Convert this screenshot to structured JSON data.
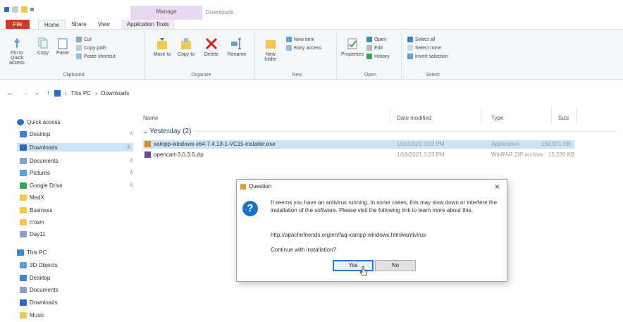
{
  "titlebar": {
    "context_tab": "Manage",
    "window_title": "Downloads"
  },
  "tabs": [
    {
      "label": "File"
    },
    {
      "label": "Home"
    },
    {
      "label": "Share"
    },
    {
      "label": "View"
    },
    {
      "label": "Application Tools"
    }
  ],
  "ribbon": {
    "clipboard": {
      "label": "Clipboard",
      "pin": "Pin to Quick access",
      "copy": "Copy",
      "paste": "Paste",
      "cut": "Cut",
      "copy_path": "Copy path",
      "paste_shortcut": "Paste shortcut"
    },
    "organize": {
      "label": "Organize",
      "move_to": "Move to",
      "copy_to": "Copy to",
      "delete": "Delete",
      "rename": "Rename"
    },
    "new": {
      "label": "New",
      "new_folder": "New folder",
      "new_item": "New item",
      "easy_access": "Easy access"
    },
    "open": {
      "label": "Open",
      "properties": "Properties",
      "open": "Open",
      "edit": "Edit",
      "history": "History"
    },
    "select": {
      "label": "Select",
      "select_all": "Select all",
      "select_none": "Select none",
      "invert": "Invert selection"
    }
  },
  "addressbar": {
    "crumbs": [
      "This PC",
      "Downloads"
    ]
  },
  "navpane": {
    "items": [
      {
        "label": "Quick access",
        "color": "#1e73c9"
      },
      {
        "label": "Desktop",
        "color": "#3a86d4"
      },
      {
        "label": "Downloads",
        "color": "#2b6cc0"
      },
      {
        "label": "Documents",
        "color": "#8aa4c0"
      },
      {
        "label": "Pictures",
        "color": "#5aa0d8"
      },
      {
        "label": "Google Drive",
        "color": "#36a852"
      },
      {
        "label": "MedX",
        "color": "#f2c94c"
      },
      {
        "label": "Business",
        "color": "#f2c94c"
      },
      {
        "label": "n'own",
        "color": "#f2c94c"
      },
      {
        "label": "Day11",
        "color": "#8aa4c0"
      },
      {
        "label": "This PC",
        "color": "#3a86d4"
      },
      {
        "label": "3D Objects",
        "color": "#5aa0d8"
      },
      {
        "label": "Desktop",
        "color": "#3a86d4"
      },
      {
        "label": "Documents",
        "color": "#8aa4c0"
      },
      {
        "label": "Downloads",
        "color": "#2b6cc0"
      },
      {
        "label": "Music",
        "color": "#f2c94c"
      }
    ]
  },
  "filelist": {
    "columns": [
      "Name",
      "Date modified",
      "Type",
      "Size"
    ],
    "group": "Yesterday (2)",
    "rows": [
      {
        "name": "xampp-windows-x64-7.4.13-1-VC15-installer.exe",
        "date": "1/19/2021 3:03 PM",
        "type": "Application",
        "size": "156,871 KB"
      },
      {
        "name": "opencart-3.0.3.6.zip",
        "date": "1/19/2021 3:23 PM",
        "type": "WinRAR ZIP archive",
        "size": "15,220 KB"
      }
    ]
  },
  "dialog": {
    "title": "Question",
    "close": "×",
    "icon": "?",
    "message": "It seems you have an antivirus running. In some cases, this may slow down or interfere the installation of the software. Please visit the following link to learn more about this.",
    "url": "http://apachefriends.org/en/faq-xampp-windows.html#antivirus",
    "question": "Continue with installation?",
    "yes": "Yes",
    "no": "No"
  },
  "colors": {
    "file_tab": "#c8402a",
    "selection": "#cce4f7",
    "accent": "#1e73c9"
  }
}
